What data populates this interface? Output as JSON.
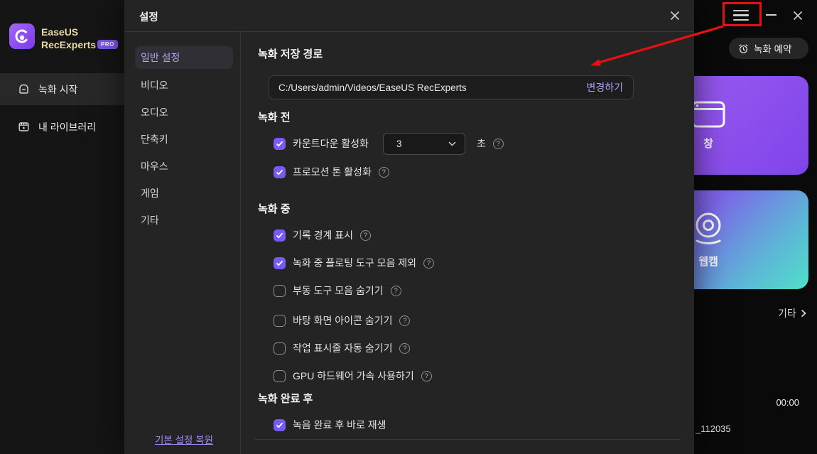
{
  "sidebar": {
    "app_name_line1": "EaseUS",
    "app_name_line2": "RecExperts",
    "pro_badge": "PRO",
    "items": [
      {
        "label": "녹화 시작",
        "icon": "home-icon",
        "selected": true
      },
      {
        "label": "내 라이브러리",
        "icon": "library-icon",
        "selected": false
      }
    ]
  },
  "main": {
    "schedule_button_label": "녹화 예약",
    "cards": [
      {
        "label": "창",
        "icon": "window-icon"
      },
      {
        "label": "웹캠",
        "icon": "webcam-icon"
      }
    ],
    "more_label": "기타",
    "duration": "00:00",
    "filename_fragment": "_112035"
  },
  "dialog": {
    "title": "설정",
    "nav": [
      {
        "label": "일반 설정",
        "selected": true
      },
      {
        "label": "비디오",
        "selected": false
      },
      {
        "label": "오디오",
        "selected": false
      },
      {
        "label": "단축키",
        "selected": false
      },
      {
        "label": "마우스",
        "selected": false
      },
      {
        "label": "게임",
        "selected": false
      },
      {
        "label": "기타",
        "selected": false
      }
    ],
    "save_path_section": {
      "heading": "녹화 저장 경로",
      "path_value": "C:/Users/admin/Videos/EaseUS RecExperts",
      "change_button": "변경하기"
    },
    "before_section": {
      "heading": "녹화 전",
      "rows": [
        {
          "label": "카운트다운 활성화",
          "checked": true,
          "dropdown_value": "3",
          "suffix": "초",
          "help": true
        },
        {
          "label": "프로모션 톤 활성화",
          "checked": true,
          "help": true
        }
      ]
    },
    "during_section": {
      "heading": "녹화 중",
      "rows": [
        {
          "label": "기록 경계 표시",
          "checked": true,
          "help": true
        },
        {
          "label": "녹화 중 플로팅 도구 모음 제외",
          "checked": true,
          "help": true
        },
        {
          "label": "부동 도구 모음 숨기기",
          "checked": false,
          "help": true
        },
        {
          "label": "바탕 화면 아이콘 숨기기",
          "checked": false,
          "help": true
        },
        {
          "label": "작업 표시줄 자동 숨기기",
          "checked": false,
          "help": true
        },
        {
          "label": "GPU 하드웨어 가속 사용하기",
          "checked": false,
          "help": true
        }
      ]
    },
    "after_section": {
      "heading": "녹화 완료 후",
      "rows": [
        {
          "label": "녹음 완료 후 바로 재생",
          "checked": true,
          "help": false
        }
      ]
    },
    "restore_link": "기본 설정 복원"
  },
  "colors": {
    "accent_purple": "#7a5af5",
    "link_purple": "#b3a0f2",
    "highlight_red": "#e81010",
    "dialog_bg": "#242424",
    "sidebar_bg": "#151515"
  }
}
